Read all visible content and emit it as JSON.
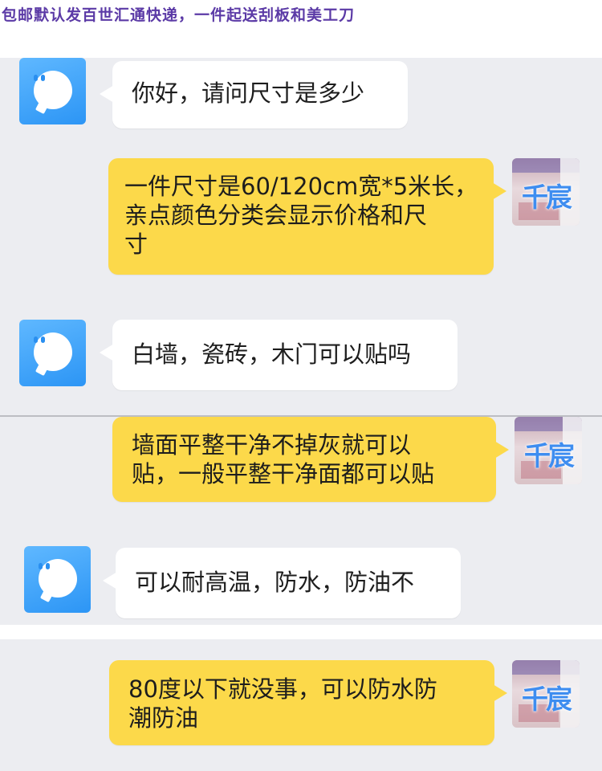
{
  "banner": {
    "text": "包邮默认发百世汇通快递，一件起送刮板和美工刀"
  },
  "shop": {
    "avatar_name": "千宸"
  },
  "colors": {
    "banner_text": "#5b3aa6",
    "chat_background": "#ecedf1",
    "incoming_bubble": "#ffffff",
    "outgoing_bubble": "#fcd94a",
    "bot_avatar": "#2c95f5"
  },
  "messages": [
    {
      "side": "left",
      "lines": [
        "你好，请问尺寸是多少"
      ]
    },
    {
      "side": "right",
      "lines": [
        "一件尺寸是60/120cm宽*5米长，",
        "亲点颜色分类会显示价格和尺",
        "寸"
      ]
    },
    {
      "side": "left",
      "lines": [
        "白墙，瓷砖，木门可以贴吗"
      ]
    },
    {
      "side": "right",
      "lines": [
        "墙面平整干净不掉灰就可以",
        "贴，一般平整干净面都可以贴"
      ]
    },
    {
      "side": "left",
      "lines": [
        "可以耐高温，防水，防油不"
      ]
    },
    {
      "side": "right",
      "lines": [
        "80度以下就没事，可以防水防",
        "潮防油"
      ]
    }
  ]
}
